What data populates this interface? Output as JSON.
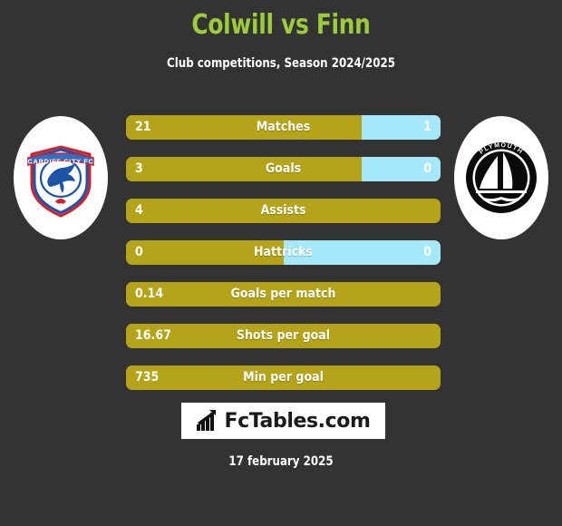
{
  "header": {
    "title": "Colwill vs Finn",
    "subtitle": "Club competitions, Season 2024/2025",
    "title_color": "#9ccc3c",
    "subtitle_color": "#ffffff"
  },
  "background_color": "#333333",
  "teams": {
    "home": {
      "name": "Cardiff City FC",
      "crest_text": "CARDIFF CITY FC",
      "icon": "cardiff-city-crest",
      "colors": {
        "shield": "#1c54a8",
        "trim": "#d3202a",
        "bird": "#1c54a8",
        "disc": "#ffffff"
      }
    },
    "away": {
      "name": "Plymouth Argyle",
      "crest_text": "PLYMOUTH",
      "icon": "plymouth-argyle-crest",
      "colors": {
        "ring": "#0a0a0a",
        "sail": "#ffffff",
        "disc": "#ffffff"
      }
    }
  },
  "bar_colors": {
    "left": "#b5a419",
    "right": "#a5e8fb"
  },
  "chart_data": {
    "type": "bar",
    "title": "Colwill vs Finn",
    "subtitle": "Club competitions, Season 2024/2025",
    "orientation": "horizontal-split",
    "series": [
      {
        "name": "Colwill",
        "side": "left",
        "color": "#b5a419"
      },
      {
        "name": "Finn",
        "side": "right",
        "color": "#a5e8fb"
      }
    ],
    "categories": [
      "Matches",
      "Goals",
      "Assists",
      "Hattricks",
      "Goals per match",
      "Shots per goal",
      "Min per goal"
    ],
    "rows": [
      {
        "label": "Matches",
        "left_value": "21",
        "right_value": "1",
        "left_pct": 75,
        "has_right": true
      },
      {
        "label": "Goals",
        "left_value": "3",
        "right_value": "0",
        "left_pct": 75,
        "has_right": true
      },
      {
        "label": "Assists",
        "left_value": "4",
        "right_value": "",
        "left_pct": 100,
        "has_right": false
      },
      {
        "label": "Hattricks",
        "left_value": "0",
        "right_value": "0",
        "left_pct": 50,
        "has_right": true
      },
      {
        "label": "Goals per match",
        "left_value": "0.14",
        "right_value": "",
        "left_pct": 100,
        "has_right": false
      },
      {
        "label": "Shots per goal",
        "left_value": "16.67",
        "right_value": "",
        "left_pct": 100,
        "has_right": false
      },
      {
        "label": "Min per goal",
        "left_value": "735",
        "right_value": "",
        "left_pct": 100,
        "has_right": false
      }
    ]
  },
  "footer": {
    "brand": "FcTables.com",
    "brand_icon": "bar-chart-arrow-icon",
    "date": "17 february 2025"
  }
}
